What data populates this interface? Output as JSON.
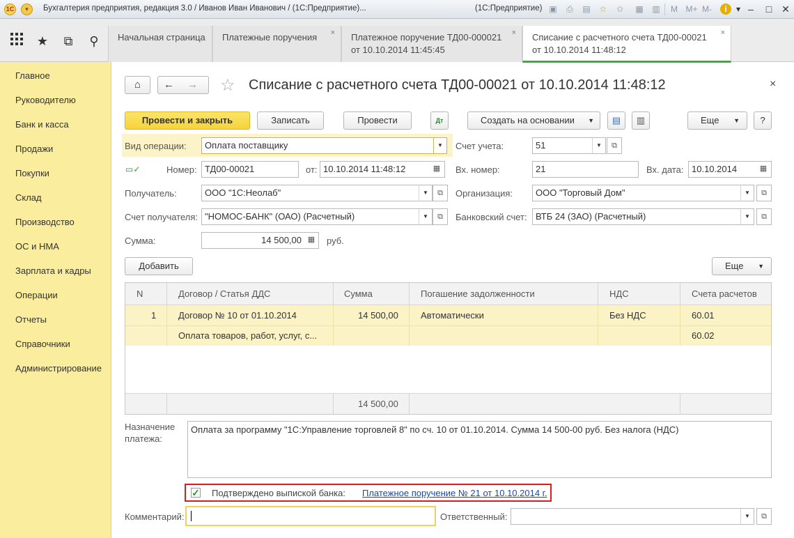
{
  "window": {
    "title": "Бухгалтерия предприятия, редакция 3.0 / Иванов Иван Иванович / (1С:Предприятие)...",
    "platform": "(1С:Предприятие)",
    "logo_text": "1С",
    "memory_buttons": [
      "M",
      "M+",
      "M-"
    ]
  },
  "tabs": [
    {
      "line1": "Начальная страница",
      "line2": ""
    },
    {
      "line1": "Платежные поручения",
      "line2": ""
    },
    {
      "line1": "Платежное поручение ТД00-000021",
      "line2": "от 10.10.2014 11:45:45"
    },
    {
      "line1": "Списание с расчетного счета ТД00-00021",
      "line2": "от 10.10.2014 11:48:12"
    }
  ],
  "sidebar": {
    "items": [
      "Главное",
      "Руководителю",
      "Банк и касса",
      "Продажи",
      "Покупки",
      "Склад",
      "Производство",
      "ОС и НМА",
      "Зарплата и кадры",
      "Операции",
      "Отчеты",
      "Справочники",
      "Администрирование"
    ]
  },
  "document": {
    "title": "Списание с расчетного счета ТД00-00021 от 10.10.2014 11:48:12"
  },
  "toolbar": {
    "post_close": "Провести и закрыть",
    "save": "Записать",
    "post": "Провести",
    "create_based": "Создать на основании",
    "more": "Еще",
    "help": "?"
  },
  "form": {
    "op_type_label": "Вид операции:",
    "op_type_value": "Оплата поставщику",
    "account_label": "Счет учета:",
    "account_value": "51",
    "number_label": "Номер:",
    "number_value": "ТД00-00021",
    "from_label": "от:",
    "from_value": "10.10.2014 11:48:12",
    "in_number_label": "Вх. номер:",
    "in_number_value": "21",
    "in_date_label": "Вх. дата:",
    "in_date_value": "10.10.2014",
    "recipient_label": "Получатель:",
    "recipient_value": "ООО \"1С:Неолаб\"",
    "org_label": "Организация:",
    "org_value": "ООО \"Торговый Дом\"",
    "recipient_acc_label": "Счет получателя:",
    "recipient_acc_value": "\"НОМОС-БАНК\" (ОАО) (Расчетный)",
    "bank_acc_label": "Банковский счет:",
    "bank_acc_value": "ВТБ 24 (ЗАО) (Расчетный)",
    "sum_label": "Сумма:",
    "sum_value": "14 500,00",
    "currency": "руб."
  },
  "table_toolbar": {
    "add": "Добавить",
    "more": "Еще"
  },
  "table": {
    "headers": [
      "N",
      "Договор / Статья ДДС",
      "Сумма",
      "Погашение задолженности",
      "НДС",
      "Счета расчетов"
    ],
    "rows": [
      {
        "n": "1",
        "contract": "Договор № 10 от 01.10.2014",
        "item": "Оплата товаров, работ, услуг, с...",
        "sum": "14 500,00",
        "repayment": "Автоматически",
        "vat": "Без НДС",
        "acc1": "60.01",
        "acc2": "60.02"
      }
    ],
    "total": "14 500,00"
  },
  "purpose": {
    "label1": "Назначение",
    "label2": "платежа:",
    "text": "Оплата за программу \"1С:Управление торговлей 8\" по сч. 10 от 01.10.2014.  Сумма 14 500-00 руб. Без налога (НДС)"
  },
  "confirm": {
    "label": "Подтверждено выпиской банка:",
    "link": "Платежное поручение № 21 от 10.10.2014 г.",
    "checked": true
  },
  "comment": {
    "label": "Комментарий:",
    "value": "",
    "responsible_label": "Ответственный:",
    "responsible_value": ""
  },
  "colors": {
    "sidebar": "#fbed9e",
    "primary_button": "#f5d33a",
    "active_tab_underline": "#3daa3d",
    "confirm_border": "#d22020",
    "link": "#1a4aa0"
  }
}
